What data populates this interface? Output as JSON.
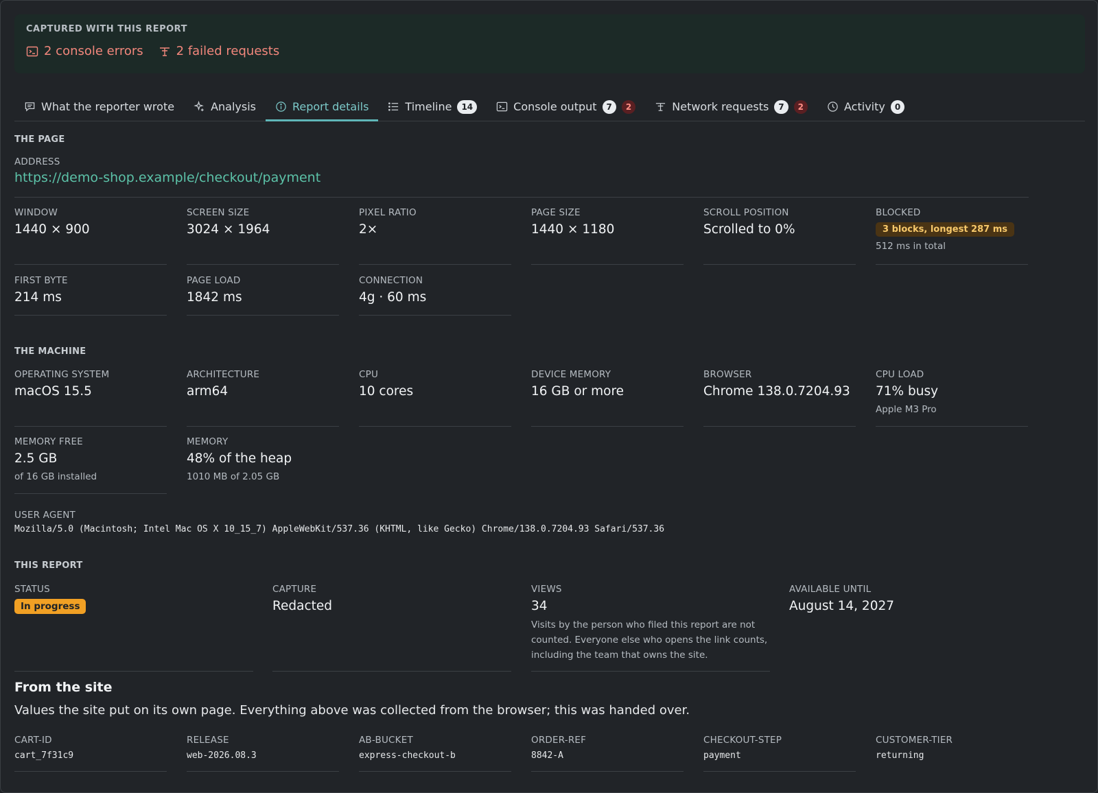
{
  "captured": {
    "title": "CAPTURED WITH THIS REPORT",
    "console_errors": "2 console errors",
    "failed_requests": "2 failed requests",
    "accent": "#f2877c"
  },
  "tabs": [
    {
      "label": "What the reporter wrote",
      "icon": "message-icon"
    },
    {
      "label": "Analysis",
      "icon": "sparkle-icon"
    },
    {
      "label": "Report details",
      "icon": "info-icon",
      "active": true
    },
    {
      "label": "Timeline",
      "icon": "list-icon",
      "count": "14"
    },
    {
      "label": "Console output",
      "icon": "terminal-icon",
      "count": "7",
      "errors": "2"
    },
    {
      "label": "Network requests",
      "icon": "network-icon",
      "count": "7",
      "errors": "2"
    },
    {
      "label": "Activity",
      "icon": "clock-icon",
      "count": "0"
    }
  ],
  "page": {
    "title": "THE PAGE",
    "address_label": "ADDRESS",
    "address": "https://demo-shop.example/checkout/payment",
    "window": {
      "label": "WINDOW",
      "value": "1440 × 900"
    },
    "screen_size": {
      "label": "SCREEN SIZE",
      "value": "3024 × 1964"
    },
    "pixel_ratio": {
      "label": "PIXEL RATIO",
      "value": "2×"
    },
    "page_size": {
      "label": "PAGE SIZE",
      "value": "1440 × 1180"
    },
    "scroll": {
      "label": "SCROLL POSITION",
      "value": "Scrolled to 0%"
    },
    "blocked": {
      "label": "BLOCKED",
      "badge": "3 blocks, longest 287 ms",
      "sub": "512 ms in total"
    },
    "first_byte": {
      "label": "FIRST BYTE",
      "value": "214 ms"
    },
    "page_load": {
      "label": "PAGE LOAD",
      "value": "1842 ms"
    },
    "connection": {
      "label": "CONNECTION",
      "value": "4g · 60 ms"
    }
  },
  "machine": {
    "title": "THE MACHINE",
    "os": {
      "label": "OPERATING SYSTEM",
      "value": "macOS 15.5"
    },
    "arch": {
      "label": "ARCHITECTURE",
      "value": "arm64"
    },
    "cpu": {
      "label": "CPU",
      "value": "10 cores"
    },
    "device_memory": {
      "label": "DEVICE MEMORY",
      "value": "16 GB or more"
    },
    "browser": {
      "label": "BROWSER",
      "value": "Chrome 138.0.7204.93"
    },
    "cpu_load": {
      "label": "CPU LOAD",
      "value": "71% busy",
      "sub": "Apple M3 Pro"
    },
    "memory_free": {
      "label": "MEMORY FREE",
      "value": "2.5 GB",
      "sub": "of 16 GB installed"
    },
    "memory": {
      "label": "MEMORY",
      "value": "48% of the heap",
      "sub": "1010 MB of 2.05 GB"
    },
    "user_agent_label": "USER AGENT",
    "user_agent": "Mozilla/5.0 (Macintosh; Intel Mac OS X 10_15_7) AppleWebKit/537.36 (KHTML, like Gecko) Chrome/138.0.7204.93 Safari/537.36"
  },
  "report": {
    "title": "THIS REPORT",
    "status": {
      "label": "STATUS",
      "value": "In progress"
    },
    "capture": {
      "label": "CAPTURE",
      "value": "Redacted"
    },
    "views": {
      "label": "VIEWS",
      "value": "34",
      "sub": "Visits by the person who filed this report are not counted. Everyone else who opens the link counts, including the team that owns the site."
    },
    "available": {
      "label": "AVAILABLE UNTIL",
      "value": "August 14, 2027"
    }
  },
  "site": {
    "title": "From the site",
    "desc": "Values the site put on its own page. Everything above was collected from the browser; this was handed over.",
    "fields": [
      {
        "label": "CART-ID",
        "value": "cart_7f31c9"
      },
      {
        "label": "RELEASE",
        "value": "web-2026.08.3"
      },
      {
        "label": "AB-BUCKET",
        "value": "express-checkout-b"
      },
      {
        "label": "ORDER-REF",
        "value": "8842-A"
      },
      {
        "label": "CHECKOUT-STEP",
        "value": "payment"
      },
      {
        "label": "CUSTOMER-TIER",
        "value": "returning"
      }
    ]
  }
}
